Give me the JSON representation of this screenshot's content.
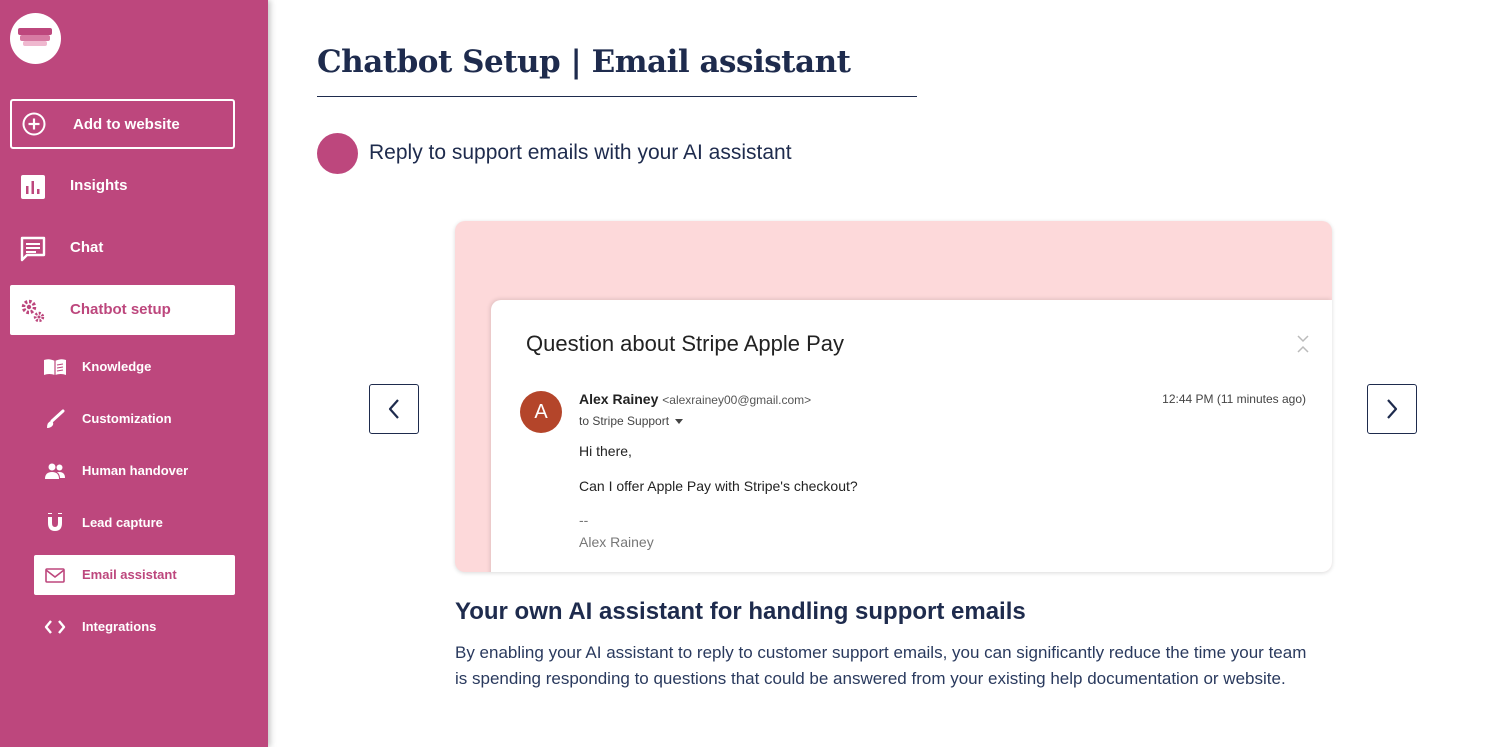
{
  "sidebar": {
    "add_button": {
      "label": "Add to website",
      "icon": "plus-circle-icon"
    },
    "items": [
      {
        "label": "Insights",
        "icon": "bar-chart-icon"
      },
      {
        "label": "Chat",
        "icon": "chat-icon"
      },
      {
        "label": "Chatbot setup",
        "icon": "gears-icon",
        "active": true
      }
    ],
    "sub_items": [
      {
        "label": "Knowledge",
        "icon": "book-icon"
      },
      {
        "label": "Customization",
        "icon": "brush-icon"
      },
      {
        "label": "Human handover",
        "icon": "people-icon"
      },
      {
        "label": "Lead capture",
        "icon": "magnet-icon"
      },
      {
        "label": "Email assistant",
        "icon": "envelope-icon",
        "active": true
      },
      {
        "label": "Integrations",
        "icon": "code-icon"
      }
    ]
  },
  "main": {
    "title": "Chatbot Setup | Email assistant",
    "step_text": "Reply to support emails with your AI assistant",
    "slide": {
      "subject": "Question about Stripe Apple Pay",
      "avatar_letter": "A",
      "sender_name": "Alex Rainey",
      "sender_email": "<alexrainey00@gmail.com>",
      "time": "12:44 PM (11 minutes ago)",
      "recipient": "to Stripe Support",
      "greeting": "Hi there,",
      "body": "Can I offer Apple Pay with Stripe's checkout?",
      "sig_separator": "--",
      "signature": "Alex Rainey"
    },
    "section_heading": "Your own AI assistant for handling support emails",
    "section_body": "By enabling your AI assistant to reply to customer support emails, you can significantly reduce the time your team is spending responding to questions that could be answered from your existing help documentation or website."
  },
  "colors": {
    "sidebar": "#bd477d",
    "navy": "#1e2b4d",
    "slide_bg": "#fdd9da",
    "avatar": "#b4452a"
  }
}
